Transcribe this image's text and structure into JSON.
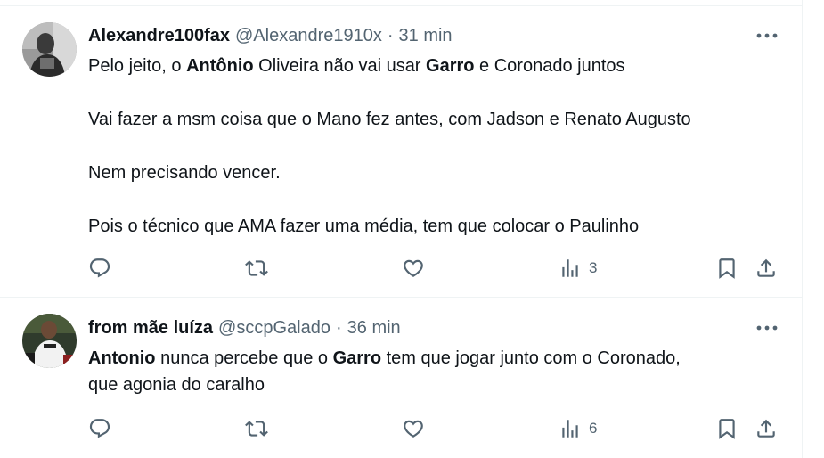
{
  "tweets": [
    {
      "author": {
        "display_name": "Alexandre100fax",
        "handle": "@Alexandre1910x"
      },
      "separator": "·",
      "time": "31 min",
      "paragraphs": [
        [
          {
            "text": "Pelo jeito, o ",
            "bold": false
          },
          {
            "text": "Antônio",
            "bold": true
          },
          {
            "text": " Oliveira não vai usar ",
            "bold": false
          },
          {
            "text": "Garro",
            "bold": true
          },
          {
            "text": " e Coronado juntos",
            "bold": false
          }
        ],
        [
          {
            "text": "Vai fazer a msm coisa que o Mano fez antes, com Jadson e Renato Augusto",
            "bold": false
          }
        ],
        [
          {
            "text": "Nem precisando vencer.",
            "bold": false
          }
        ],
        [
          {
            "text": "Pois o técnico que AMA fazer uma média, tem que colocar o Paulinho",
            "bold": false
          }
        ]
      ],
      "actions": {
        "views": "3"
      }
    },
    {
      "author": {
        "display_name": "from mãe luíza",
        "handle": "@sccpGalado"
      },
      "separator": "·",
      "time": "36 min",
      "lines": [
        [
          {
            "text": "Antonio",
            "bold": true
          },
          {
            "text": " nunca percebe que o ",
            "bold": false
          },
          {
            "text": "Garro",
            "bold": true
          },
          {
            "text": " tem que jogar junto com o Coronado,",
            "bold": false
          }
        ],
        [
          {
            "text": "que agonia do caralho",
            "bold": false
          }
        ]
      ],
      "actions": {
        "views": "6"
      }
    }
  ],
  "icons": {
    "reply": "reply-icon",
    "retweet": "retweet-icon",
    "like": "like-icon",
    "views": "views-icon",
    "bookmark": "bookmark-icon",
    "share": "share-icon",
    "more": "more-icon"
  },
  "colors": {
    "text": "#0f1419",
    "secondary": "#536471",
    "border": "#eff3f4"
  }
}
